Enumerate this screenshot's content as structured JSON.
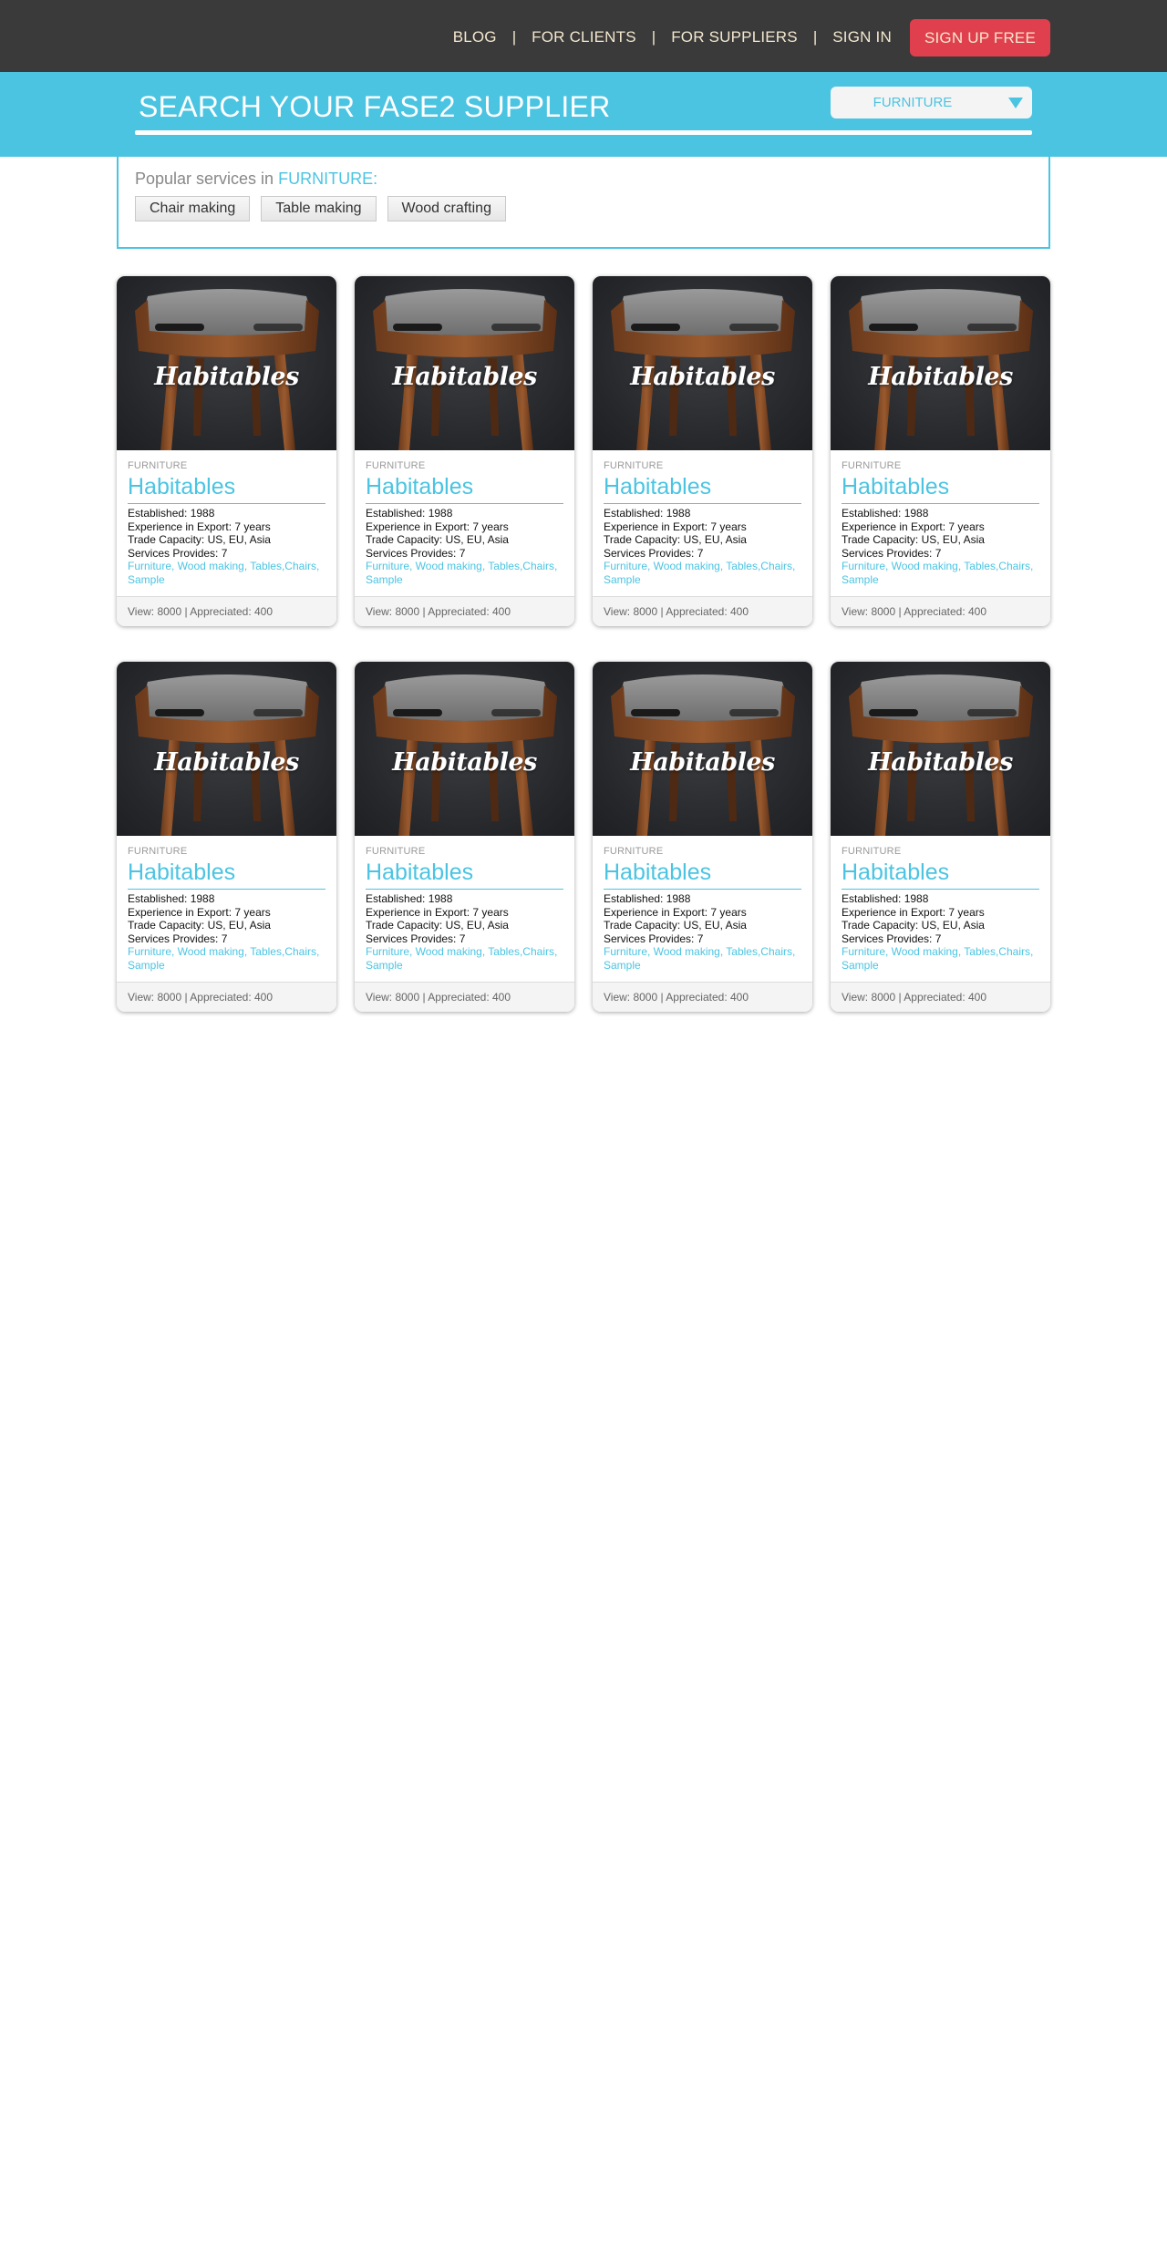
{
  "nav": {
    "items": [
      "BLOG",
      "FOR CLIENTS",
      "FOR SUPPLIERS",
      "SIGN IN"
    ],
    "separator": "|",
    "signup_label": "SIGN UP FREE"
  },
  "search": {
    "title": "SEARCH YOUR FASE2 SUPPLIER",
    "category_selected": "FURNITURE"
  },
  "popular": {
    "prefix": "Popular services in ",
    "category": "FURNITURE:",
    "chips": [
      "Chair making",
      "Table making",
      "Wood crafting"
    ]
  },
  "cards": [
    {
      "image_brand": "Habitables",
      "category": "FURNITURE",
      "name": "Habitables",
      "established": "Established: 1988",
      "experience": "Experience in Export: 7 years",
      "capacity": "Trade Capacity: US, EU, Asia",
      "services": "Services Provides: 7",
      "tags": "Furniture, Wood making, Tables,Chairs, Sample",
      "stats": "View: 8000 | Appreciated: 400"
    },
    {
      "image_brand": "Habitables",
      "category": "FURNITURE",
      "name": "Habitables",
      "established": "Established: 1988",
      "experience": "Experience in Export: 7 years",
      "capacity": "Trade Capacity: US, EU, Asia",
      "services": "Services Provides: 7",
      "tags": "Furniture, Wood making, Tables,Chairs, Sample",
      "stats": "View: 8000 | Appreciated: 400"
    },
    {
      "image_brand": "Habitables",
      "category": "FURNITURE",
      "name": "Habitables",
      "established": "Established: 1988",
      "experience": "Experience in Export: 7 years",
      "capacity": "Trade Capacity: US, EU, Asia",
      "services": "Services Provides: 7",
      "tags": "Furniture, Wood making, Tables,Chairs, Sample",
      "stats": "View: 8000 | Appreciated: 400"
    },
    {
      "image_brand": "Habitables",
      "category": "FURNITURE",
      "name": "Habitables",
      "established": "Established: 1988",
      "experience": "Experience in Export: 7 years",
      "capacity": "Trade Capacity: US, EU, Asia",
      "services": "Services Provides: 7",
      "tags": "Furniture, Wood making, Tables,Chairs, Sample",
      "stats": "View: 8000 | Appreciated: 400"
    },
    {
      "image_brand": "Habitables",
      "category": "FURNITURE",
      "name": "Habitables",
      "established": "Established: 1988",
      "experience": "Experience in Export: 7 years",
      "capacity": "Trade Capacity: US, EU, Asia",
      "services": "Services Provides: 7",
      "tags": "Furniture, Wood making, Tables,Chairs, Sample",
      "stats": "View: 8000 | Appreciated: 400"
    },
    {
      "image_brand": "Habitables",
      "category": "FURNITURE",
      "name": "Habitables",
      "established": "Established: 1988",
      "experience": "Experience in Export: 7 years",
      "capacity": "Trade Capacity: US, EU, Asia",
      "services": "Services Provides: 7",
      "tags": "Furniture, Wood making, Tables,Chairs, Sample",
      "stats": "View: 8000 | Appreciated: 400"
    },
    {
      "image_brand": "Habitables",
      "category": "FURNITURE",
      "name": "Habitables",
      "established": "Established: 1988",
      "experience": "Experience in Export: 7 years",
      "capacity": "Trade Capacity: US, EU, Asia",
      "services": "Services Provides: 7",
      "tags": "Furniture, Wood making, Tables,Chairs, Sample",
      "stats": "View: 8000 | Appreciated: 400"
    },
    {
      "image_brand": "Habitables",
      "category": "FURNITURE",
      "name": "Habitables",
      "established": "Established: 1988",
      "experience": "Experience in Export: 7 years",
      "capacity": "Trade Capacity: US, EU, Asia",
      "services": "Services Provides: 7",
      "tags": "Furniture, Wood making, Tables,Chairs, Sample",
      "stats": "View: 8000 | Appreciated: 400"
    }
  ],
  "colors": {
    "accent": "#4bc4e2",
    "topbar": "#3a3a3a",
    "signup": "#e0404e",
    "nav_text": "#f3e7cf"
  },
  "icons": {
    "dropdown": "triangle-down-icon"
  }
}
